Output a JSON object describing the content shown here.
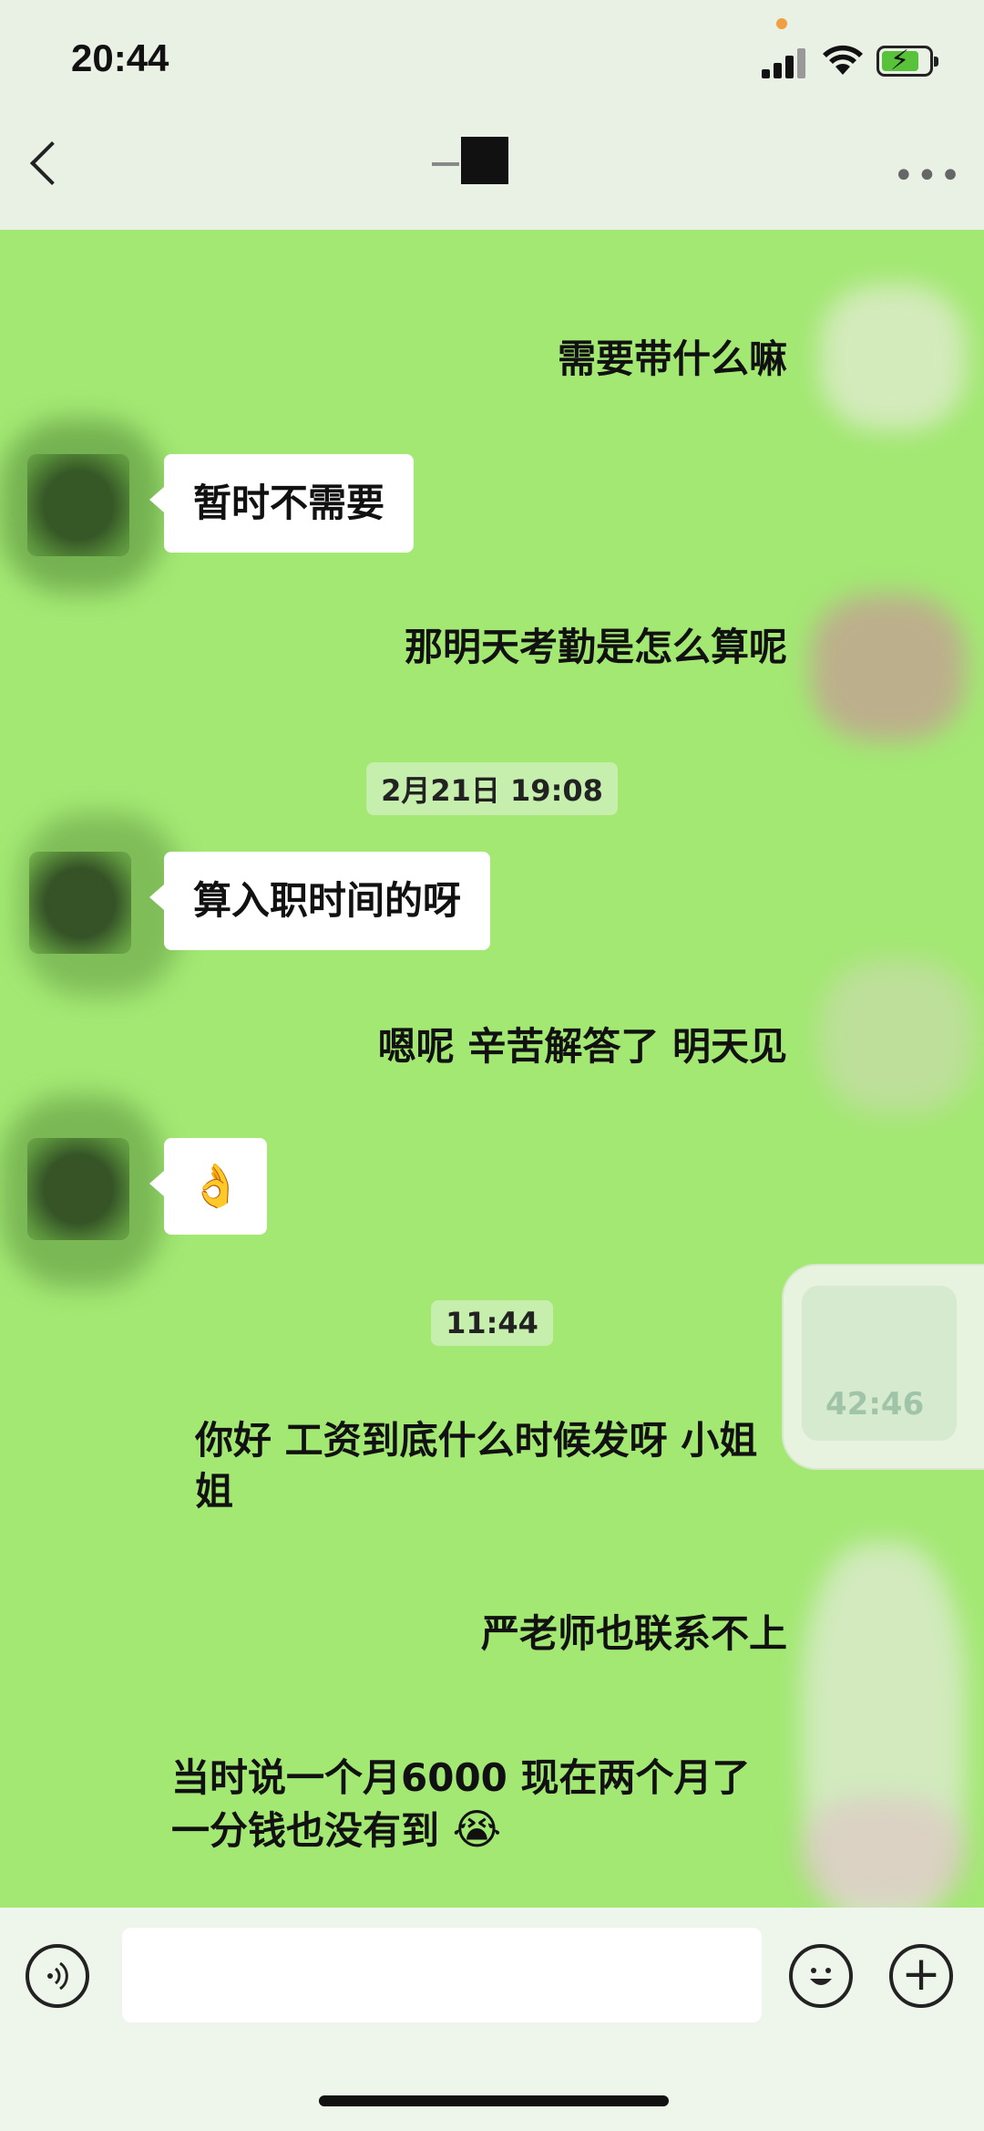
{
  "status_bar": {
    "time": "20:44"
  },
  "nav": {
    "back_icon": "chevron-left-icon",
    "more_icon": "ellipsis-icon"
  },
  "messages": {
    "m1_right": "需要带什么嘛",
    "m2_left": "暂时不需要",
    "m3_right": "那明天考勤是怎么算呢",
    "stamp1": "2月21日 19:08",
    "m4_left": "算入职时间的呀",
    "m5_right": "嗯呢 辛苦解答了 明天见",
    "m6_left_emoji": "👌",
    "stamp2": "11:44",
    "m7_line1": "你好 工资到底什么时候发呀 小姐",
    "m7_line2": "姐",
    "m8_right": "严老师也联系不上",
    "m9_line1": "当时说一个月6000 现在两个月了",
    "m9_line2": "一分钱也没有到",
    "m9_emoji": "😭"
  },
  "float_widget": {
    "timer": "42:46"
  },
  "input_bar": {
    "placeholder": "",
    "voice_icon": "voice-icon",
    "emoji_icon": "smiley-icon",
    "plus_icon": "plus-icon"
  }
}
